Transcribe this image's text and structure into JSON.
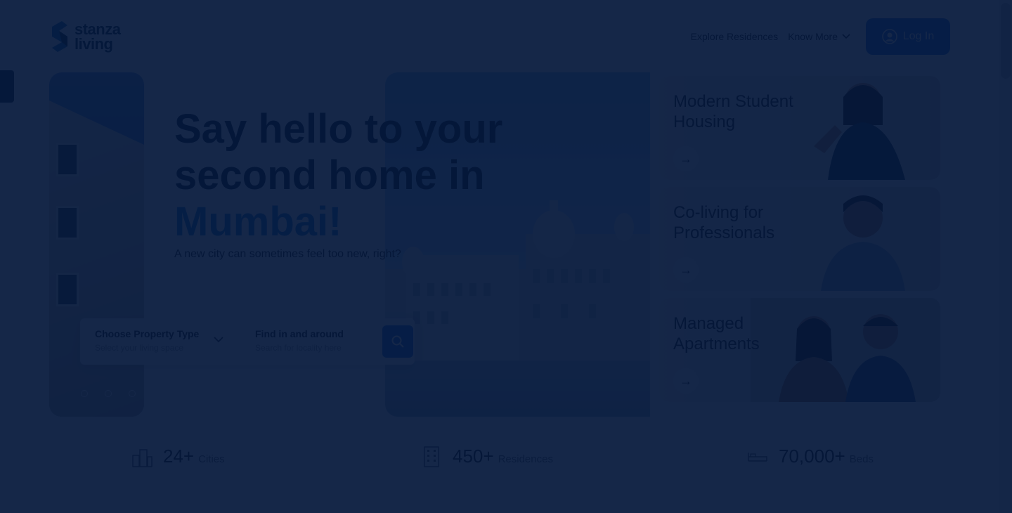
{
  "brand": {
    "line1": "stanza",
    "line2": "living"
  },
  "nav": {
    "explore": "Explore Residences",
    "know_more": "Know More",
    "login": "Log In"
  },
  "hero": {
    "headline_1": "Say hello to your",
    "headline_2": "second home in",
    "city": "Mumbai!",
    "tagline": "A new city can sometimes feel too new, right?"
  },
  "search": {
    "property_label": "Choose Property Type",
    "property_hint": "Select your living space",
    "location_label": "Find in and around",
    "location_hint": "Search for locality here"
  },
  "cards": [
    {
      "title": "Modern Student Housing"
    },
    {
      "title": "Co-living for Professionals"
    },
    {
      "title": "Managed Apartments"
    }
  ],
  "stats": [
    {
      "number": "24+",
      "label": "Cities",
      "icon": "city-icon"
    },
    {
      "number": "450+",
      "label": "Residences",
      "icon": "building-icon"
    },
    {
      "number": "70,000+",
      "label": "Beds",
      "icon": "bed-icon"
    }
  ],
  "colors": {
    "overlay": "#03173a",
    "accent": "#2a73d9",
    "city": "#1f7fd3"
  }
}
